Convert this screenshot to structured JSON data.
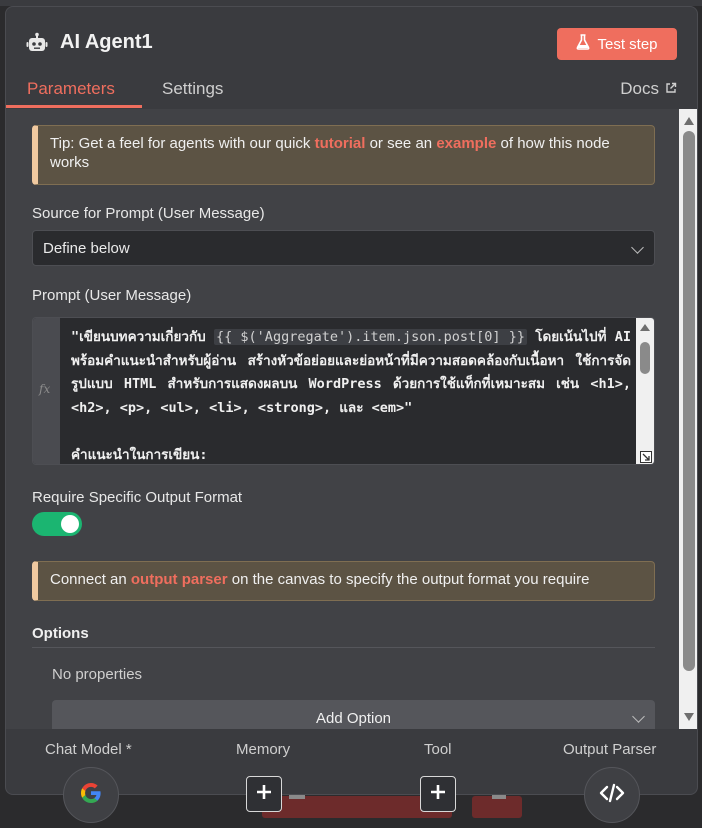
{
  "header": {
    "title": "AI Agent1",
    "test_step_label": "Test step"
  },
  "tabs": {
    "parameters": "Parameters",
    "settings": "Settings",
    "docs": "Docs"
  },
  "tip": {
    "prefix": "Tip: Get a feel for agents with our quick ",
    "link1": "tutorial",
    "middle": " or see an ",
    "link2": "example",
    "suffix": " of how this node works"
  },
  "source_prompt": {
    "label": "Source for Prompt (User Message)",
    "value": "Define below"
  },
  "prompt": {
    "label": "Prompt (User Message)",
    "fx": "fx",
    "part1": "\"เขียนบทความเกี่ยวกับ ",
    "expression": "{{ $('Aggregate').item.json.post[0] }}",
    "part2": "  โดยเน้นไปที่ AI พร้อมคำแนะนำสำหรับผู้อ่าน สร้างหัวข้อย่อยและย่อหน้าที่มีความสอดคล้องกับเนื้อหา ใช้การจัดรูปแบบ HTML สำหรับการแสดงผลบน WordPress ด้วยการใช้แท็กที่เหมาะสม เช่น <h1>, <h2>, <p>, <ul>, <li>, <strong>, และ <em>\"",
    "line_next": "คำแนะนำในการเขียน:"
  },
  "output_format": {
    "label": "Require Specific Output Format",
    "enabled": true
  },
  "parser_notice": {
    "prefix": "Connect an ",
    "link": "output parser",
    "suffix": " on the canvas to specify the output format you require"
  },
  "options": {
    "title": "Options",
    "empty": "No properties",
    "add_label": "Add Option"
  },
  "connectors": {
    "chat_model": "Chat Model *",
    "memory": "Memory",
    "tool": "Tool",
    "output_parser": "Output Parser"
  },
  "colors": {
    "accent": "#ef6e5e",
    "toggle_on": "#1bb571",
    "panel_bg": "#3a3b3f"
  },
  "icons": {
    "title": "robot-icon",
    "test_step": "flask-icon",
    "docs": "external-link-icon",
    "chat_model": "google-icon",
    "memory": "plus-icon",
    "tool": "plus-icon",
    "output_parser": "code-icon"
  }
}
